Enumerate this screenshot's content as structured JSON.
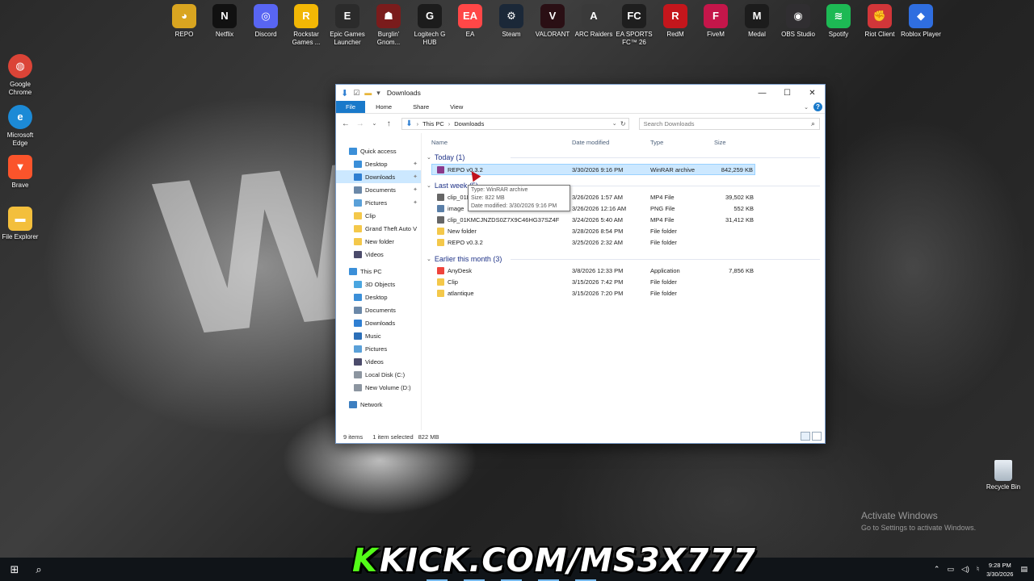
{
  "desktop": {
    "top_icons": [
      {
        "label": "REPO",
        "name": "repo-icon",
        "color": "#d9a520",
        "glyph": "◕"
      },
      {
        "label": "Netflix",
        "name": "netflix-icon",
        "color": "#111111",
        "glyph": "N"
      },
      {
        "label": "Discord",
        "name": "discord-icon",
        "color": "#5865f2",
        "glyph": "◎"
      },
      {
        "label": "Rockstar Games ...",
        "name": "rockstar-games-icon",
        "color": "#f2b705",
        "glyph": "R"
      },
      {
        "label": "Epic Games Launcher",
        "name": "epic-games-icon",
        "color": "#2b2b2b",
        "glyph": "E"
      },
      {
        "label": "Burglin' Gnom...",
        "name": "burglin-gnomes-icon",
        "color": "#7a1c1c",
        "glyph": "☗"
      },
      {
        "label": "Logitech G HUB",
        "name": "logitech-g-hub-icon",
        "color": "#1c1c1c",
        "glyph": "G"
      },
      {
        "label": "EA",
        "name": "ea-icon",
        "color": "#ff4747",
        "glyph": "EA"
      },
      {
        "label": "Steam",
        "name": "steam-icon",
        "color": "#1b2838",
        "glyph": "⚙"
      },
      {
        "label": "VALORANT",
        "name": "valorant-icon",
        "color": "#2a0f14",
        "glyph": "V"
      },
      {
        "label": "ARC Raiders",
        "name": "arc-raiders-icon",
        "color": "#3a3a3a",
        "glyph": "A"
      },
      {
        "label": "EA SPORTS FC™ 26",
        "name": "ea-sports-fc-icon",
        "color": "#1e1e1e",
        "glyph": "FC"
      },
      {
        "label": "RedM",
        "name": "redm-icon",
        "color": "#c4161c",
        "glyph": "R"
      },
      {
        "label": "FiveM",
        "name": "fivem-icon",
        "color": "#c4164a",
        "glyph": "F"
      },
      {
        "label": "Medal",
        "name": "medal-icon",
        "color": "#1c1c1c",
        "glyph": "M"
      },
      {
        "label": "OBS Studio",
        "name": "obs-studio-icon",
        "color": "#302e31",
        "glyph": "◉"
      },
      {
        "label": "Spotify",
        "name": "spotify-icon",
        "color": "#1db954",
        "glyph": "≋"
      },
      {
        "label": "Riot Client",
        "name": "riot-client-icon",
        "color": "#d13639",
        "glyph": "✊"
      },
      {
        "label": "Roblox Player",
        "name": "roblox-player-icon",
        "color": "#2f6ee0",
        "glyph": "◆"
      }
    ],
    "left_icons": [
      {
        "label": "Google Chrome",
        "name": "google-chrome-icon",
        "color": "#db4437",
        "glyph": "◍"
      },
      {
        "label": "Microsoft Edge",
        "name": "microsoft-edge-icon",
        "color": "#1c8ad6",
        "glyph": "e"
      },
      {
        "label": "Brave",
        "name": "brave-icon",
        "color": "#fb542b",
        "glyph": "▼"
      },
      {
        "label": "File Explorer",
        "name": "file-explorer-icon",
        "color": "#f3bf3c",
        "glyph": "▬"
      }
    ],
    "recycle_bin": "Recycle Bin",
    "activate_title": "Activate Windows",
    "activate_sub": "Go to Settings to activate Windows."
  },
  "explorer": {
    "title": "Downloads",
    "tabs": [
      "File",
      "Home",
      "Share",
      "View"
    ],
    "breadcrumb": [
      "This PC",
      "Downloads"
    ],
    "search_placeholder": "Search Downloads",
    "columns": {
      "name": "Name",
      "date": "Date modified",
      "type": "Type",
      "size": "Size"
    },
    "nav": [
      {
        "label": "Quick access",
        "icon": "star-icon",
        "indent": 0,
        "pinned": false,
        "selected": false,
        "cls": "ic-blue"
      },
      {
        "label": "Desktop",
        "icon": "desktop-icon",
        "indent": 1,
        "pinned": true,
        "selected": false,
        "cls": "ic-blue"
      },
      {
        "label": "Downloads",
        "icon": "downloads-icon",
        "indent": 1,
        "pinned": true,
        "selected": true,
        "cls": "ic-dl"
      },
      {
        "label": "Documents",
        "icon": "documents-icon",
        "indent": 1,
        "pinned": true,
        "selected": false,
        "cls": "ic-doc"
      },
      {
        "label": "Pictures",
        "icon": "pictures-icon",
        "indent": 1,
        "pinned": true,
        "selected": false,
        "cls": "ic-pic"
      },
      {
        "label": "Clip",
        "icon": "folder-icon",
        "indent": 1,
        "pinned": false,
        "selected": false,
        "cls": "ic-folder"
      },
      {
        "label": "Grand Theft Auto V",
        "icon": "folder-icon",
        "indent": 1,
        "pinned": false,
        "selected": false,
        "cls": "ic-folder"
      },
      {
        "label": "New folder",
        "icon": "folder-icon",
        "indent": 1,
        "pinned": false,
        "selected": false,
        "cls": "ic-folder"
      },
      {
        "label": "Videos",
        "icon": "videos-icon",
        "indent": 1,
        "pinned": false,
        "selected": false,
        "cls": "ic-vid"
      },
      {
        "label": "",
        "icon": "",
        "indent": 0,
        "pinned": false,
        "selected": false,
        "cls": "",
        "spacer": true
      },
      {
        "label": "This PC",
        "icon": "this-pc-icon",
        "indent": 0,
        "pinned": false,
        "selected": false,
        "cls": "ic-pc"
      },
      {
        "label": "3D Objects",
        "icon": "3d-objects-icon",
        "indent": 1,
        "pinned": false,
        "selected": false,
        "cls": "ic-3d"
      },
      {
        "label": "Desktop",
        "icon": "desktop-icon",
        "indent": 1,
        "pinned": false,
        "selected": false,
        "cls": "ic-blue"
      },
      {
        "label": "Documents",
        "icon": "documents-icon",
        "indent": 1,
        "pinned": false,
        "selected": false,
        "cls": "ic-doc"
      },
      {
        "label": "Downloads",
        "icon": "downloads-icon",
        "indent": 1,
        "pinned": false,
        "selected": false,
        "cls": "ic-dl"
      },
      {
        "label": "Music",
        "icon": "music-icon",
        "indent": 1,
        "pinned": false,
        "selected": false,
        "cls": "ic-music"
      },
      {
        "label": "Pictures",
        "icon": "pictures-icon",
        "indent": 1,
        "pinned": false,
        "selected": false,
        "cls": "ic-pic"
      },
      {
        "label": "Videos",
        "icon": "videos-icon",
        "indent": 1,
        "pinned": false,
        "selected": false,
        "cls": "ic-vid"
      },
      {
        "label": "Local Disk (C:)",
        "icon": "local-disk-icon",
        "indent": 1,
        "pinned": false,
        "selected": false,
        "cls": "ic-disk"
      },
      {
        "label": "New Volume (D:)",
        "icon": "drive-icon",
        "indent": 1,
        "pinned": false,
        "selected": false,
        "cls": "ic-disk"
      },
      {
        "label": "",
        "icon": "",
        "indent": 0,
        "pinned": false,
        "selected": false,
        "cls": "",
        "spacer": true
      },
      {
        "label": "Network",
        "icon": "network-icon",
        "indent": 0,
        "pinned": false,
        "selected": false,
        "cls": "ic-net"
      }
    ],
    "groups": [
      {
        "title": "Today (1)",
        "files": [
          {
            "name": "REPO v0.3.2",
            "date": "3/30/2026 9:16 PM",
            "type": "WinRAR archive",
            "size": "842,259 KB",
            "icon": "winrar-archive-icon",
            "color": "#8b3a8b",
            "selected": true
          }
        ]
      },
      {
        "title": "Last week (5)",
        "files": [
          {
            "name": "clip_01KM",
            "date": "3/26/2026 1:57 AM",
            "type": "MP4 File",
            "size": "39,502 KB",
            "icon": "video-file-icon",
            "color": "#666666",
            "selected": false
          },
          {
            "name": "image",
            "date": "3/26/2026 12:16 AM",
            "type": "PNG File",
            "size": "552 KB",
            "icon": "image-file-icon",
            "color": "#5a7fa8",
            "selected": false
          },
          {
            "name": "clip_01KMCJNZDS0Z7X9C46HG37SZ4F",
            "date": "3/24/2026 5:40 AM",
            "type": "MP4 File",
            "size": "31,412 KB",
            "icon": "video-file-icon",
            "color": "#666666",
            "selected": false
          },
          {
            "name": "New folder",
            "date": "3/28/2026 8:54 PM",
            "type": "File folder",
            "size": "",
            "icon": "folder-icon",
            "color": "#f4c84a",
            "selected": false
          },
          {
            "name": "REPO v0.3.2",
            "date": "3/25/2026 2:32 AM",
            "type": "File folder",
            "size": "",
            "icon": "folder-icon",
            "color": "#f4c84a",
            "selected": false
          }
        ]
      },
      {
        "title": "Earlier this month (3)",
        "files": [
          {
            "name": "AnyDesk",
            "date": "3/8/2026 12:33 PM",
            "type": "Application",
            "size": "7,856 KB",
            "icon": "anydesk-icon",
            "color": "#ef443b",
            "selected": false
          },
          {
            "name": "Clip",
            "date": "3/15/2026 7:42 PM",
            "type": "File folder",
            "size": "",
            "icon": "folder-icon",
            "color": "#f4c84a",
            "selected": false
          },
          {
            "name": "atlantique",
            "date": "3/15/2026 7:20 PM",
            "type": "File folder",
            "size": "",
            "icon": "folder-icon",
            "color": "#f4c84a",
            "selected": false
          }
        ]
      }
    ],
    "tooltip": [
      "Type: WinRAR archive",
      "Size: 822 MB",
      "Date modified: 3/30/2026 9:16 PM"
    ],
    "status": {
      "items": "9 items",
      "selected": "1 item selected",
      "size": "822 MB"
    }
  },
  "taskbar": {
    "banner_k": "K",
    "banner_text": "KICK.COM/MS3X777",
    "time": "9:28 PM",
    "date": "3/30/2026"
  }
}
